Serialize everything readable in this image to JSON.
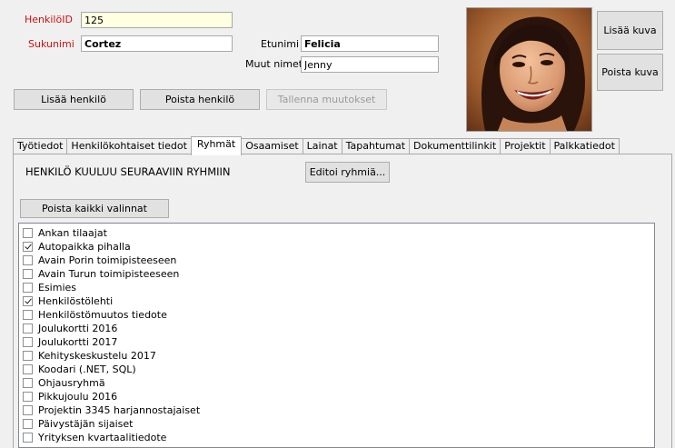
{
  "person": {
    "id_label": "HenkilöID",
    "id_value": "125",
    "lastname_label": "Sukunimi",
    "lastname_value": "Cortez",
    "firstname_label": "Etunimi",
    "firstname_value": "Felicia",
    "othernames_label": "Muut nimet",
    "othernames_value": "Jenny"
  },
  "photo_actions": {
    "add_label": "Lisää kuva",
    "remove_label": "Poista kuva"
  },
  "actions": {
    "add_person": "Lisää henkilö",
    "remove_person": "Poista henkilö",
    "save_changes": "Tallenna muutokset"
  },
  "tabs": [
    {
      "label": "Työtiedot",
      "active": false
    },
    {
      "label": "Henkilökohtaiset tiedot",
      "active": false
    },
    {
      "label": "Ryhmät",
      "active": true
    },
    {
      "label": "Osaamiset",
      "active": false
    },
    {
      "label": "Lainat",
      "active": false
    },
    {
      "label": "Tapahtumat",
      "active": false
    },
    {
      "label": "Dokumenttilinkit",
      "active": false
    },
    {
      "label": "Projektit",
      "active": false
    },
    {
      "label": "Palkkatiedot",
      "active": false
    }
  ],
  "groups": {
    "heading": "HENKILÖ KUULUU SEURAAVIIN RYHMIIN",
    "edit_button": "Editoi ryhmiä...",
    "clear_button": "Poista kaikki valinnat",
    "items": [
      {
        "label": "Ankan tilaajat",
        "checked": false
      },
      {
        "label": "Autopaikka pihalla",
        "checked": true
      },
      {
        "label": "Avain Porin toimipisteeseen",
        "checked": false
      },
      {
        "label": "Avain Turun toimipisteeseen",
        "checked": false
      },
      {
        "label": "Esimies",
        "checked": false
      },
      {
        "label": "Henkilöstölehti",
        "checked": true
      },
      {
        "label": "Henkilöstömuutos tiedote",
        "checked": false
      },
      {
        "label": "Joulukortti 2016",
        "checked": false
      },
      {
        "label": "Joulukortti 2017",
        "checked": false
      },
      {
        "label": "Kehityskeskustelu 2017",
        "checked": false
      },
      {
        "label": "Koodari (.NET, SQL)",
        "checked": false
      },
      {
        "label": "Ohjausryhmä",
        "checked": false
      },
      {
        "label": "Pikkujoulu 2016",
        "checked": false
      },
      {
        "label": "Projektin 3345 harjannostajaiset",
        "checked": false
      },
      {
        "label": "Päivystäjän sijaiset",
        "checked": false
      },
      {
        "label": "Yrityksen kvartaalitiedote",
        "checked": false
      }
    ]
  }
}
